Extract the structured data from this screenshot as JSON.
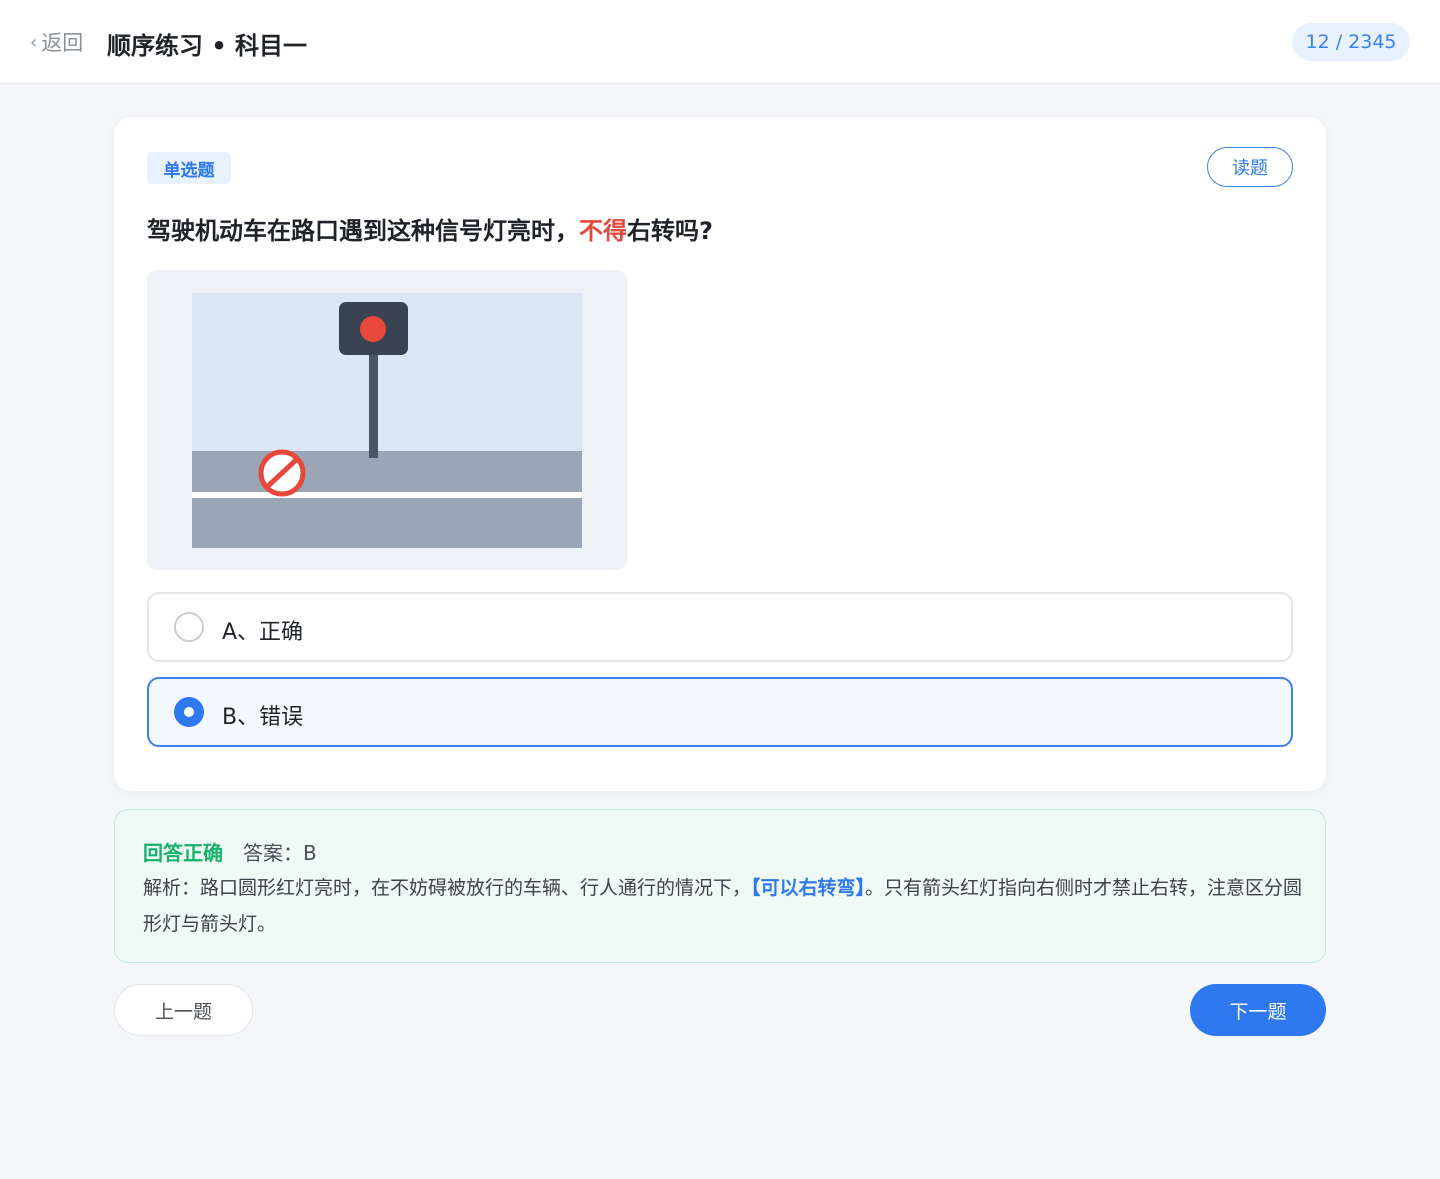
{
  "header": {
    "back_chevron": "‹",
    "back_label": "返回",
    "title": "顺序练习 • 科目一",
    "counter": "12 / 2345"
  },
  "question": {
    "type_badge": "单选题",
    "read_button": "读题",
    "text_before": "驾驶机动车在路口遇到这种信号灯亮时，",
    "text_highlight": "不得",
    "text_after": "右转吗?",
    "image_icons": [
      "traffic-light-icon",
      "no-entry-icon"
    ],
    "colors": {
      "highlight": "#e8473b",
      "accent": "#2e78f0",
      "success": "#17b26a"
    }
  },
  "options": [
    {
      "label": "A、正确",
      "selected": false
    },
    {
      "label": "B、错误",
      "selected": true
    }
  ],
  "analysis": {
    "status": "回答正确",
    "answer": "答案：B",
    "explain_before": "解析：路口圆形红灯亮时，在不妨碍被放行的车辆、行人通行的情况下，",
    "explain_key": "【可以右转弯】",
    "explain_after": "。只有箭头红灯指向右侧时才禁止右转，注意区分圆形灯与箭头灯。"
  },
  "nav": {
    "prev": "上一题",
    "next": "下一题"
  }
}
